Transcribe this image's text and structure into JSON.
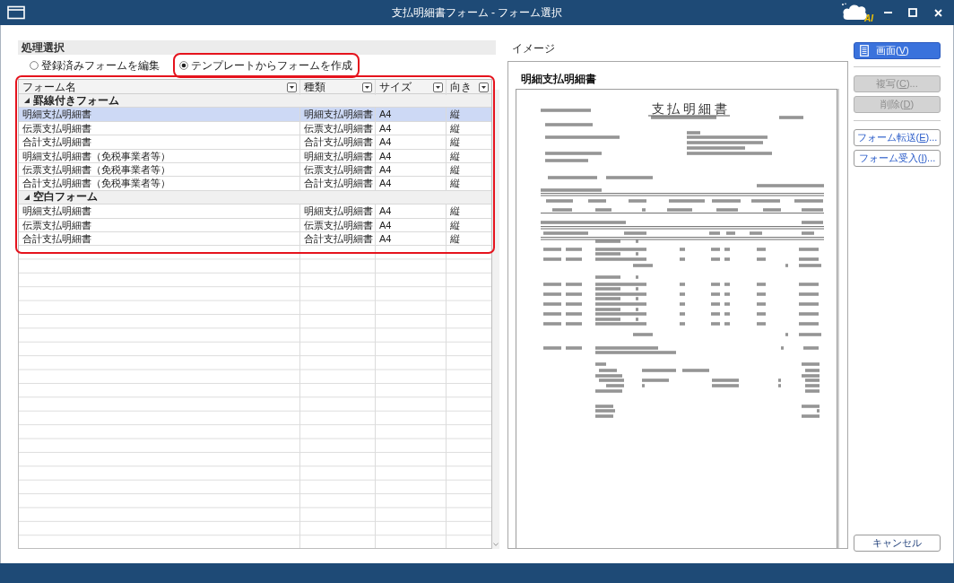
{
  "window": {
    "title": "支払明細書フォーム - フォーム選択",
    "logo_text": "AI"
  },
  "process_selection": {
    "heading": "処理選択",
    "options": [
      {
        "label": "登録済みフォームを編集",
        "selected": false,
        "highlighted": false
      },
      {
        "label": "テンプレートからフォームを作成",
        "selected": true,
        "highlighted": true
      }
    ]
  },
  "form_table": {
    "highlighted": true,
    "columns": [
      "フォーム名",
      "種類",
      "サイズ",
      "向き"
    ],
    "groups": [
      {
        "label": "罫線付きフォーム",
        "expanded": true,
        "rows": [
          {
            "cells": [
              "明細支払明細書",
              "明細支払明細書",
              "A4",
              "縦"
            ],
            "selected": true
          },
          {
            "cells": [
              "伝票支払明細書",
              "伝票支払明細書",
              "A4",
              "縦"
            ],
            "selected": false
          },
          {
            "cells": [
              "合計支払明細書",
              "合計支払明細書",
              "A4",
              "縦"
            ],
            "selected": false
          },
          {
            "cells": [
              "明細支払明細書（免税事業者等）",
              "明細支払明細書",
              "A4",
              "縦"
            ],
            "selected": false
          },
          {
            "cells": [
              "伝票支払明細書（免税事業者等）",
              "伝票支払明細書",
              "A4",
              "縦"
            ],
            "selected": false
          },
          {
            "cells": [
              "合計支払明細書（免税事業者等）",
              "合計支払明細書",
              "A4",
              "縦"
            ],
            "selected": false
          }
        ]
      },
      {
        "label": "空白フォーム",
        "expanded": true,
        "rows": [
          {
            "cells": [
              "明細支払明細書",
              "明細支払明細書",
              "A4",
              "縦"
            ],
            "selected": false
          },
          {
            "cells": [
              "伝票支払明細書",
              "伝票支払明細書",
              "A4",
              "縦"
            ],
            "selected": false
          },
          {
            "cells": [
              "合計支払明細書",
              "合計支払明細書",
              "A4",
              "縦"
            ],
            "selected": false
          }
        ]
      }
    ]
  },
  "preview": {
    "label": "イメージ",
    "heading": "明細支払明細書",
    "document_title": "支 払 明 細 書"
  },
  "action_groups": [
    [
      {
        "label": "画面(",
        "access_key": "V",
        "suffix": ")",
        "kind": "primary",
        "disabled": false
      }
    ],
    [
      {
        "label": "複写(",
        "access_key": "C",
        "suffix": ")...",
        "kind": "default",
        "disabled": true
      },
      {
        "label": "削除(",
        "access_key": "D",
        "suffix": ")",
        "kind": "default",
        "disabled": true
      }
    ],
    [
      {
        "label": "フォーム転送(",
        "access_key": "E",
        "suffix": ")...",
        "kind": "default",
        "disabled": false
      },
      {
        "label": "フォーム受入(",
        "access_key": "I",
        "suffix": ")...",
        "kind": "default",
        "disabled": false
      }
    ]
  ],
  "cancel_button": {
    "label": "キャンセル"
  }
}
